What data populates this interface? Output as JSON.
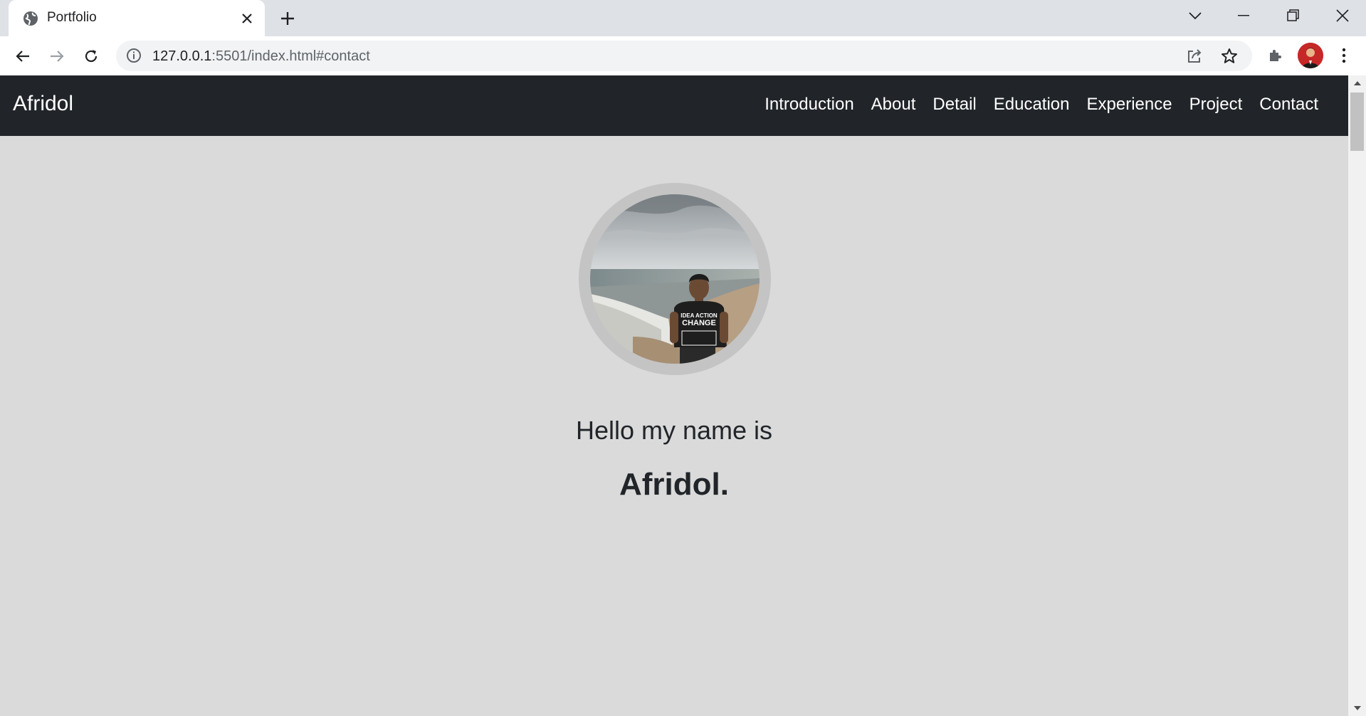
{
  "browser": {
    "tab": {
      "title": "Portfolio",
      "favicon": "globe-icon"
    },
    "url": {
      "host": "127.0.0.1",
      "rest": ":5501/index.html#contact"
    }
  },
  "page": {
    "brand": "Afridol",
    "nav": [
      {
        "label": "Introduction"
      },
      {
        "label": "About"
      },
      {
        "label": "Detail"
      },
      {
        "label": "Education"
      },
      {
        "label": "Experience"
      },
      {
        "label": "Project"
      },
      {
        "label": "Contact"
      }
    ],
    "hero": {
      "greeting": "Hello my name is",
      "name": "Afridol."
    }
  },
  "colors": {
    "navbar": "#212529",
    "page_bg": "#dadada",
    "avatar_ring": "#c4c4c4",
    "text": "#212529"
  }
}
